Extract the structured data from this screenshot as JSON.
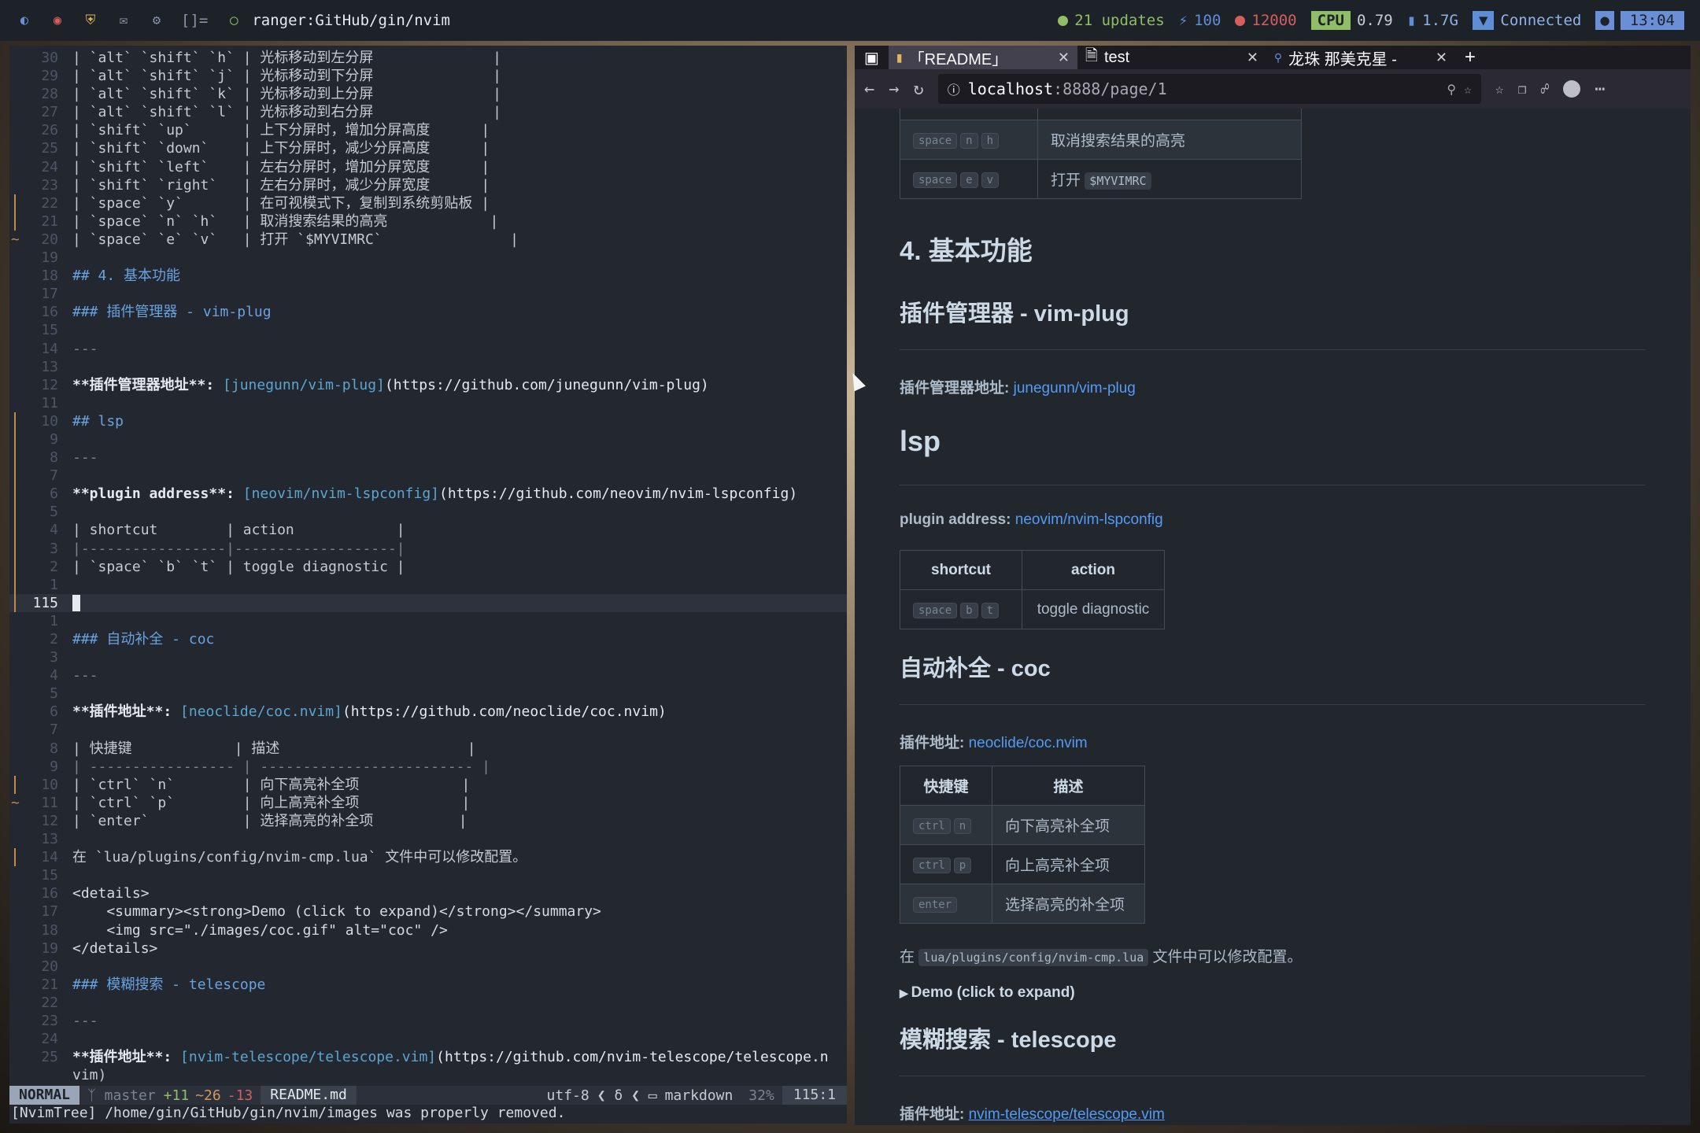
{
  "topbar": {
    "workspace": "[]=",
    "title": "ranger:GitHub/gin/nvim",
    "updates": "21 updates",
    "brightness": "100",
    "temp": "12000",
    "cpu_label": "CPU",
    "cpu_value": "0.79",
    "mem": "1.7G",
    "net": "Connected",
    "time": "13:04"
  },
  "editor": {
    "lines": [
      {
        "n": "30",
        "g": "",
        "t": "| `alt` `shift` `h` | 光标移动到左分屏              |",
        "c": ""
      },
      {
        "n": "29",
        "g": "",
        "t": "| `alt` `shift` `j` | 光标移动到下分屏              |",
        "c": ""
      },
      {
        "n": "28",
        "g": "",
        "t": "| `alt` `shift` `k` | 光标移动到上分屏              |",
        "c": ""
      },
      {
        "n": "27",
        "g": "",
        "t": "| `alt` `shift` `l` | 光标移动到右分屏              |",
        "c": ""
      },
      {
        "n": "26",
        "g": "",
        "t": "| `shift` `up`      | 上下分屏时，增加分屏高度      |",
        "c": ""
      },
      {
        "n": "25",
        "g": "",
        "t": "| `shift` `down`    | 上下分屏时，减少分屏高度      |",
        "c": ""
      },
      {
        "n": "24",
        "g": "",
        "t": "| `shift` `left`    | 左右分屏时，增加分屏宽度      |",
        "c": ""
      },
      {
        "n": "23",
        "g": "",
        "t": "| `shift` `right`   | 左右分屏时，减少分屏宽度      |",
        "c": ""
      },
      {
        "n": "22",
        "g": "bar",
        "t": "| `space` `y`       | 在可视模式下，复制到系统剪贴板 |",
        "c": ""
      },
      {
        "n": "21",
        "g": "bar",
        "t": "| `space` `n` `h`   | 取消搜索结果的高亮            |",
        "c": ""
      },
      {
        "n": "20",
        "g": "tilde",
        "t": "| `space` `e` `v`   | 打开 `$MYVIMRC`               |",
        "c": ""
      },
      {
        "n": "19",
        "g": "",
        "t": "",
        "c": ""
      },
      {
        "n": "18",
        "g": "",
        "t": "## 4. 基本功能",
        "c": "head"
      },
      {
        "n": "17",
        "g": "",
        "t": "",
        "c": ""
      },
      {
        "n": "16",
        "g": "",
        "t": "### 插件管理器 - vim-plug",
        "c": "head"
      },
      {
        "n": "15",
        "g": "",
        "t": "",
        "c": ""
      },
      {
        "n": "14",
        "g": "",
        "t": "---",
        "c": "dim"
      },
      {
        "n": "13",
        "g": "",
        "t": "",
        "c": ""
      },
      {
        "n": "12",
        "g": "",
        "t": "**插件管理器地址**: [junegunn/vim-plug](https://github.com/junegunn/vim-plug)",
        "c": "linkline"
      },
      {
        "n": "11",
        "g": "",
        "t": "",
        "c": ""
      },
      {
        "n": "10",
        "g": "bar",
        "t": "## lsp",
        "c": "head"
      },
      {
        "n": "9",
        "g": "bar",
        "t": "",
        "c": ""
      },
      {
        "n": "8",
        "g": "bar",
        "t": "---",
        "c": "dim"
      },
      {
        "n": "7",
        "g": "bar",
        "t": "",
        "c": ""
      },
      {
        "n": "6",
        "g": "bar",
        "t": "**plugin address**: [neovim/nvim-lspconfig](https://github.com/neovim/nvim-lspconfig)",
        "c": "linkline"
      },
      {
        "n": "5",
        "g": "bar",
        "t": "",
        "c": ""
      },
      {
        "n": "4",
        "g": "bar",
        "t": "| shortcut        | action            |",
        "c": ""
      },
      {
        "n": "3",
        "g": "bar",
        "t": "|-----------------|-------------------|",
        "c": "dim"
      },
      {
        "n": "2",
        "g": "bar",
        "t": "| `space` `b` `t` | toggle diagnostic |",
        "c": ""
      },
      {
        "n": "1",
        "g": "bar",
        "t": "",
        "c": ""
      },
      {
        "n": "115",
        "g": "bar",
        "t": "",
        "c": "cur"
      },
      {
        "n": "1",
        "g": "",
        "t": "",
        "c": ""
      },
      {
        "n": "2",
        "g": "",
        "t": "### 自动补全 - coc",
        "c": "head"
      },
      {
        "n": "3",
        "g": "",
        "t": "",
        "c": ""
      },
      {
        "n": "4",
        "g": "",
        "t": "---",
        "c": "dim"
      },
      {
        "n": "5",
        "g": "",
        "t": "",
        "c": ""
      },
      {
        "n": "6",
        "g": "",
        "t": "**插件地址**: [neoclide/coc.nvim](https://github.com/neoclide/coc.nvim)",
        "c": "linkline"
      },
      {
        "n": "7",
        "g": "",
        "t": "",
        "c": ""
      },
      {
        "n": "8",
        "g": "",
        "t": "| 快捷键            | 描述                      |",
        "c": ""
      },
      {
        "n": "9",
        "g": "",
        "t": "| ----------------- | ------------------------- |",
        "c": "dim"
      },
      {
        "n": "10",
        "g": "bar",
        "t": "| `ctrl` `n`        | 向下高亮补全项            |",
        "c": ""
      },
      {
        "n": "11",
        "g": "tilde",
        "t": "| `ctrl` `p`        | 向上高亮补全项            |",
        "c": ""
      },
      {
        "n": "12",
        "g": "",
        "t": "| `enter`           | 选择高亮的补全项          |",
        "c": ""
      },
      {
        "n": "13",
        "g": "",
        "t": "",
        "c": ""
      },
      {
        "n": "14",
        "g": "bar",
        "t": "在 `lua/plugins/config/nvim-cmp.lua` 文件中可以修改配置。",
        "c": ""
      },
      {
        "n": "15",
        "g": "",
        "t": "",
        "c": ""
      },
      {
        "n": "16",
        "g": "",
        "t": "<details>",
        "c": "tag"
      },
      {
        "n": "17",
        "g": "",
        "t": "    <summary><strong>Demo (click to expand)</strong></summary>",
        "c": "tag"
      },
      {
        "n": "18",
        "g": "",
        "t": "    <img src=\"./images/coc.gif\" alt=\"coc\" />",
        "c": "tag"
      },
      {
        "n": "19",
        "g": "",
        "t": "</details>",
        "c": "tag"
      },
      {
        "n": "20",
        "g": "",
        "t": "",
        "c": ""
      },
      {
        "n": "21",
        "g": "",
        "t": "### 模糊搜索 - telescope",
        "c": "head"
      },
      {
        "n": "22",
        "g": "",
        "t": "",
        "c": ""
      },
      {
        "n": "23",
        "g": "",
        "t": "---",
        "c": "dim"
      },
      {
        "n": "24",
        "g": "",
        "t": "",
        "c": ""
      },
      {
        "n": "25",
        "g": "",
        "t": "**插件地址**: [nvim-telescope/telescope.vim](https://github.com/nvim-telescope/telescope.n",
        "c": "linkline"
      },
      {
        "n": "",
        "g": "",
        "t": "vim)",
        "c": "linkline"
      }
    ],
    "status": {
      "mode": "NORMAL",
      "branch": "master",
      "added": "+11",
      "modified": "~26",
      "removed": "-13",
      "file": "README.md",
      "encoding": "utf-8",
      "filetype": "markdown",
      "percent": "32%",
      "position": "115:1"
    },
    "cmdline": "[NvimTree] /home/gin/GitHub/gin/nvim/images was properly removed."
  },
  "browser": {
    "tabs": [
      {
        "label": "「README」",
        "active": true
      },
      {
        "label": "test",
        "active": false
      },
      {
        "label": "龙珠 那美克星 -",
        "active": false
      }
    ],
    "url_host": "localhost",
    "url_rest": ":8888/page/1",
    "page": {
      "top_rows": [
        {
          "keys": [
            "space",
            "n",
            "h"
          ],
          "desc": "取消搜索结果的高亮"
        },
        {
          "keys": [
            "space",
            "e",
            "v"
          ],
          "desc": "打开",
          "code": "$MYVIMRC"
        }
      ],
      "h2_basic": "4. 基本功能",
      "h3_vimplug": "插件管理器 - vim-plug",
      "vimplug_label": "插件管理器地址:",
      "vimplug_link": "junegunn/vim-plug",
      "h2_lsp": "lsp",
      "lsp_label": "plugin address:",
      "lsp_link": "neovim/nvim-lspconfig",
      "lsp_table": {
        "headers": [
          "shortcut",
          "action"
        ],
        "rows": [
          {
            "keys": [
              "space",
              "b",
              "t"
            ],
            "desc": "toggle diagnostic"
          }
        ]
      },
      "h3_coc": "自动补全 - coc",
      "coc_label": "插件地址:",
      "coc_link": "neoclide/coc.nvim",
      "coc_table": {
        "headers": [
          "快捷键",
          "描述"
        ],
        "rows": [
          {
            "keys": [
              "ctrl",
              "n"
            ],
            "desc": "向下高亮补全项"
          },
          {
            "keys": [
              "ctrl",
              "p"
            ],
            "desc": "向上高亮补全项"
          },
          {
            "keys": [
              "enter"
            ],
            "desc": "选择高亮的补全项"
          }
        ]
      },
      "config_pre": "在",
      "config_code": "lua/plugins/config/nvim-cmp.lua",
      "config_post": "文件中可以修改配置。",
      "details_summary": "Demo (click to expand)",
      "h3_telescope": "模糊搜索 - telescope",
      "telescope_label": "插件地址:",
      "telescope_link": "nvim-telescope/telescope.vim"
    }
  }
}
